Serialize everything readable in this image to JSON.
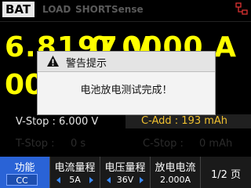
{
  "status_bar": {
    "mode": "BAT",
    "tabs": [
      "LOAD",
      "SHORT",
      "Sense"
    ],
    "network_icon": "network-icon"
  },
  "readouts": {
    "voltage": "6.8197 V",
    "current": "0.0000 A",
    "third_partial": "00"
  },
  "info": {
    "v_stop": "V-Stop :  6.000 V",
    "c_add": "C-Add : 193 mAh",
    "t_stop": "T-Stop :",
    "t_stop_value": "0 s",
    "c_stop": "C-Stop :",
    "c_stop_value": "0 mAh"
  },
  "softkeys": [
    {
      "title": "功能",
      "value": "CC"
    },
    {
      "title": "电流量程",
      "value": "5A"
    },
    {
      "title": "电压量程",
      "value": "36V"
    },
    {
      "title": "放电电流",
      "value": "2.000A"
    },
    {
      "title": "1/2 页",
      "value": ""
    }
  ],
  "dialog": {
    "title": "警告提示",
    "message": "电池放电测试完成！"
  },
  "colors": {
    "readout": "#ffff00",
    "accent": "#2a63d6",
    "c_add": "#f2c230"
  }
}
